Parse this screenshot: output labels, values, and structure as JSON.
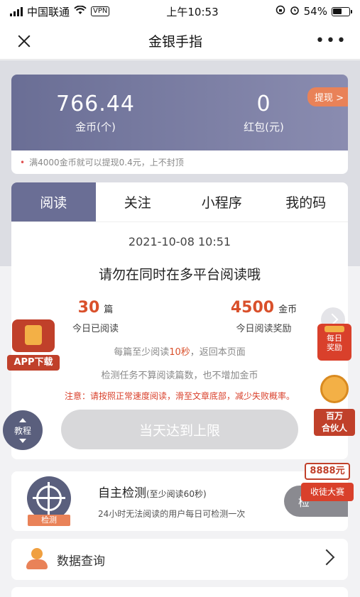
{
  "status_bar": {
    "carrier": "中国联通",
    "vpn": "VPN",
    "time": "上午10:53",
    "battery": "54%"
  },
  "nav": {
    "title": "金银手指"
  },
  "balance": {
    "coins_value": "766.44",
    "coins_label": "金币(个)",
    "red_packet_value": "0",
    "red_packet_label": "红包(元)",
    "withdraw_label": "提现 >"
  },
  "tip": {
    "text": "满4000金币就可以提现0.4元，上不封顶"
  },
  "tabs": [
    {
      "label": "阅读"
    },
    {
      "label": "关注"
    },
    {
      "label": "小程序"
    },
    {
      "label": "我的码"
    }
  ],
  "task": {
    "datetime": "2021-10-08 10:51",
    "headline": "请勿在同时在多平台阅读哦",
    "read_count": "30",
    "read_unit": "篇",
    "read_label": "今日已阅读",
    "reward_count": "4500",
    "reward_unit": "金币",
    "reward_label": "今日阅读奖励",
    "rule_prefix": "每篇至少阅读",
    "rule_highlight": "10秒",
    "rule_suffix": "，返回本页面",
    "rule_2": "检测任务不算阅读篇数，也不增加金币",
    "notice": "注意：请按照正常速度阅读，滑至文章底部，减少失败概率。",
    "button_label": "当天达到上限"
  },
  "detect": {
    "ribbon": "检测",
    "title": "自主检测",
    "title_hint": "(至少阅读60秒)",
    "desc": "24小时无法阅读的用户每日可检测一次",
    "button_label": "检"
  },
  "query": {
    "label": "数据查询"
  },
  "floats": {
    "app_download": "APP下载",
    "guide": "教程",
    "daily_reward_1": "每日",
    "daily_reward_2": "奖励",
    "partner_1": "百万",
    "partner_2": "合伙人",
    "contest_amount": "8888元",
    "contest_label": "收徒大赛"
  }
}
